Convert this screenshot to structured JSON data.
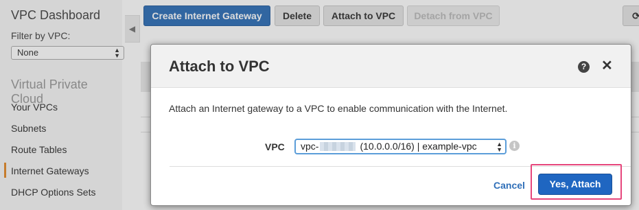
{
  "sidebar": {
    "title": "VPC Dashboard",
    "filter_label": "Filter by VPC:",
    "filter_value": "None",
    "section": "Virtual Private Cloud",
    "items": [
      {
        "label": "Your VPCs"
      },
      {
        "label": "Subnets"
      },
      {
        "label": "Route Tables"
      },
      {
        "label": "Internet Gateways"
      },
      {
        "label": "DHCP Options Sets"
      }
    ]
  },
  "toolbar": {
    "create_label": "Create Internet Gateway",
    "delete_label": "Delete",
    "attach_label": "Attach to VPC",
    "detach_label": "Detach from VPC"
  },
  "modal": {
    "title": "Attach to VPC",
    "description": "Attach an Internet gateway to a VPC to enable communication with the Internet.",
    "vpc_label": "VPC",
    "vpc_select_prefix": "vpc-",
    "vpc_select_suffix": "(10.0.0.0/16) | example-vpc",
    "cancel_label": "Cancel",
    "confirm_label": "Yes, Attach"
  },
  "colors": {
    "primary_button": "#2f6fb8",
    "confirm_button": "#1f66c1",
    "highlight_border": "#e6457b",
    "active_nav_marker": "#e58a2a"
  }
}
